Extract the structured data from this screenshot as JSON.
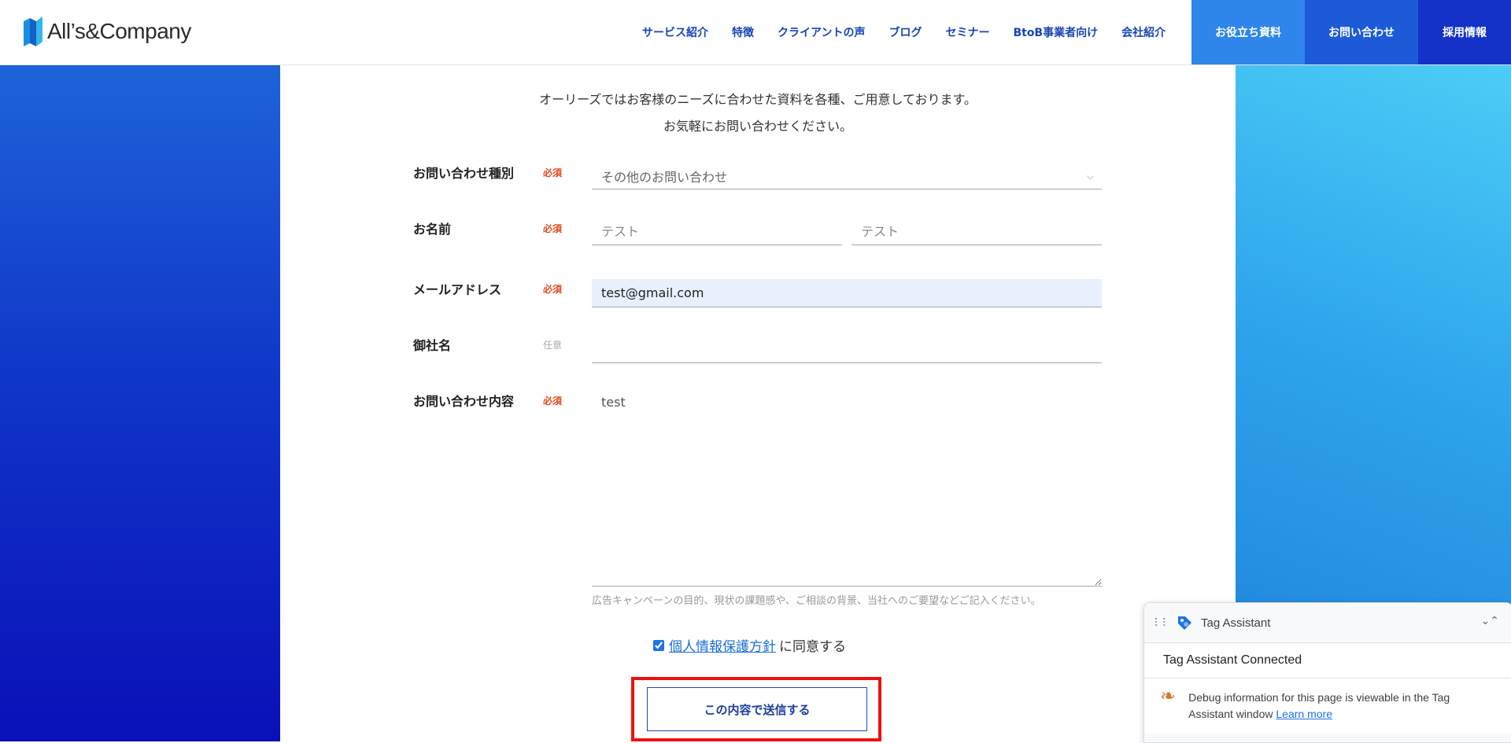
{
  "header": {
    "logo_text": "All’s&Company",
    "nav": [
      "サービス紹介",
      "特徴",
      "クライアントの声",
      "ブログ",
      "セミナー",
      "BtoB事業者向け",
      "会社紹介"
    ],
    "cta": [
      "お役立ち資料",
      "お問い合わせ",
      "採用情報"
    ]
  },
  "intro": {
    "line1": "オーリーズではお客様のニーズに合わせた資料を各種、ご用意しております。",
    "line2": "お気軽にお問い合わせください。"
  },
  "form": {
    "inquiry_type": {
      "label": "お問い合わせ種別",
      "badge": "必須",
      "value": "その他のお問い合わせ"
    },
    "name": {
      "label": "お名前",
      "badge": "必須",
      "last_value": "テスト",
      "first_value": "テスト"
    },
    "email": {
      "label": "メールアドレス",
      "badge": "必須",
      "value": "test@gmail.com"
    },
    "company": {
      "label": "御社名",
      "badge": "任意",
      "value": ""
    },
    "content": {
      "label": "お問い合わせ内容",
      "badge": "必須",
      "value": "test",
      "helper": "広告キャンペーンの目的、現状の課題感や、ご相談の背景、当社へのご要望などご記入ください。"
    },
    "agree": {
      "link_text": "個人情報保護方針",
      "suffix": "に同意する",
      "checked": true
    },
    "submit_label": "この内容で送信する"
  },
  "tag_assistant": {
    "title": "Tag Assistant",
    "status": "Tag Assistant Connected",
    "debug_text": "Debug information for this page is viewable in the Tag Assistant window",
    "learn_more": "Learn more"
  }
}
